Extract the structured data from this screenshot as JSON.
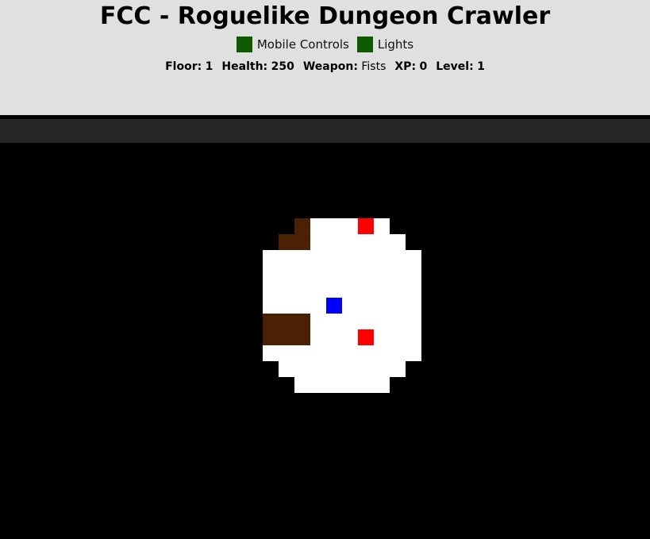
{
  "header": {
    "title": "FCC - Roguelike Dungeon Crawler",
    "toggles": [
      {
        "label": "Mobile Controls",
        "color": "#0e5a00"
      },
      {
        "label": "Lights",
        "color": "#0e5a00"
      }
    ],
    "stats": {
      "floor_label": "Floor:",
      "floor": "1",
      "health_label": "Health:",
      "health": "250",
      "weapon_label": "Weapon:",
      "weapon": "Fists",
      "xp_label": "XP:",
      "xp": "0",
      "level_label": "Level:",
      "level": "1"
    }
  },
  "colors": {
    "floor": "#ffffff",
    "wall": "#4a2102",
    "enemy": "#ff0000",
    "player": "#0000ff",
    "darkness": "#000000"
  },
  "map_legend": {
    "F": "floor",
    "W": "wall",
    "E": "enemy",
    "P": "player"
  },
  "visible_map": [
    "..WFFFEF..",
    ".WWFFFFFF.",
    "FFFFFFFFFF",
    "FFFFFFFFFF",
    "FFFFFFFFFF",
    "FFFFPFFFFF",
    "WWWFFFFFFF",
    "WWWFFFEFFF",
    "FFFFFFFFFF",
    ".FFFFFFFF.",
    "..FFFFFF.."
  ]
}
